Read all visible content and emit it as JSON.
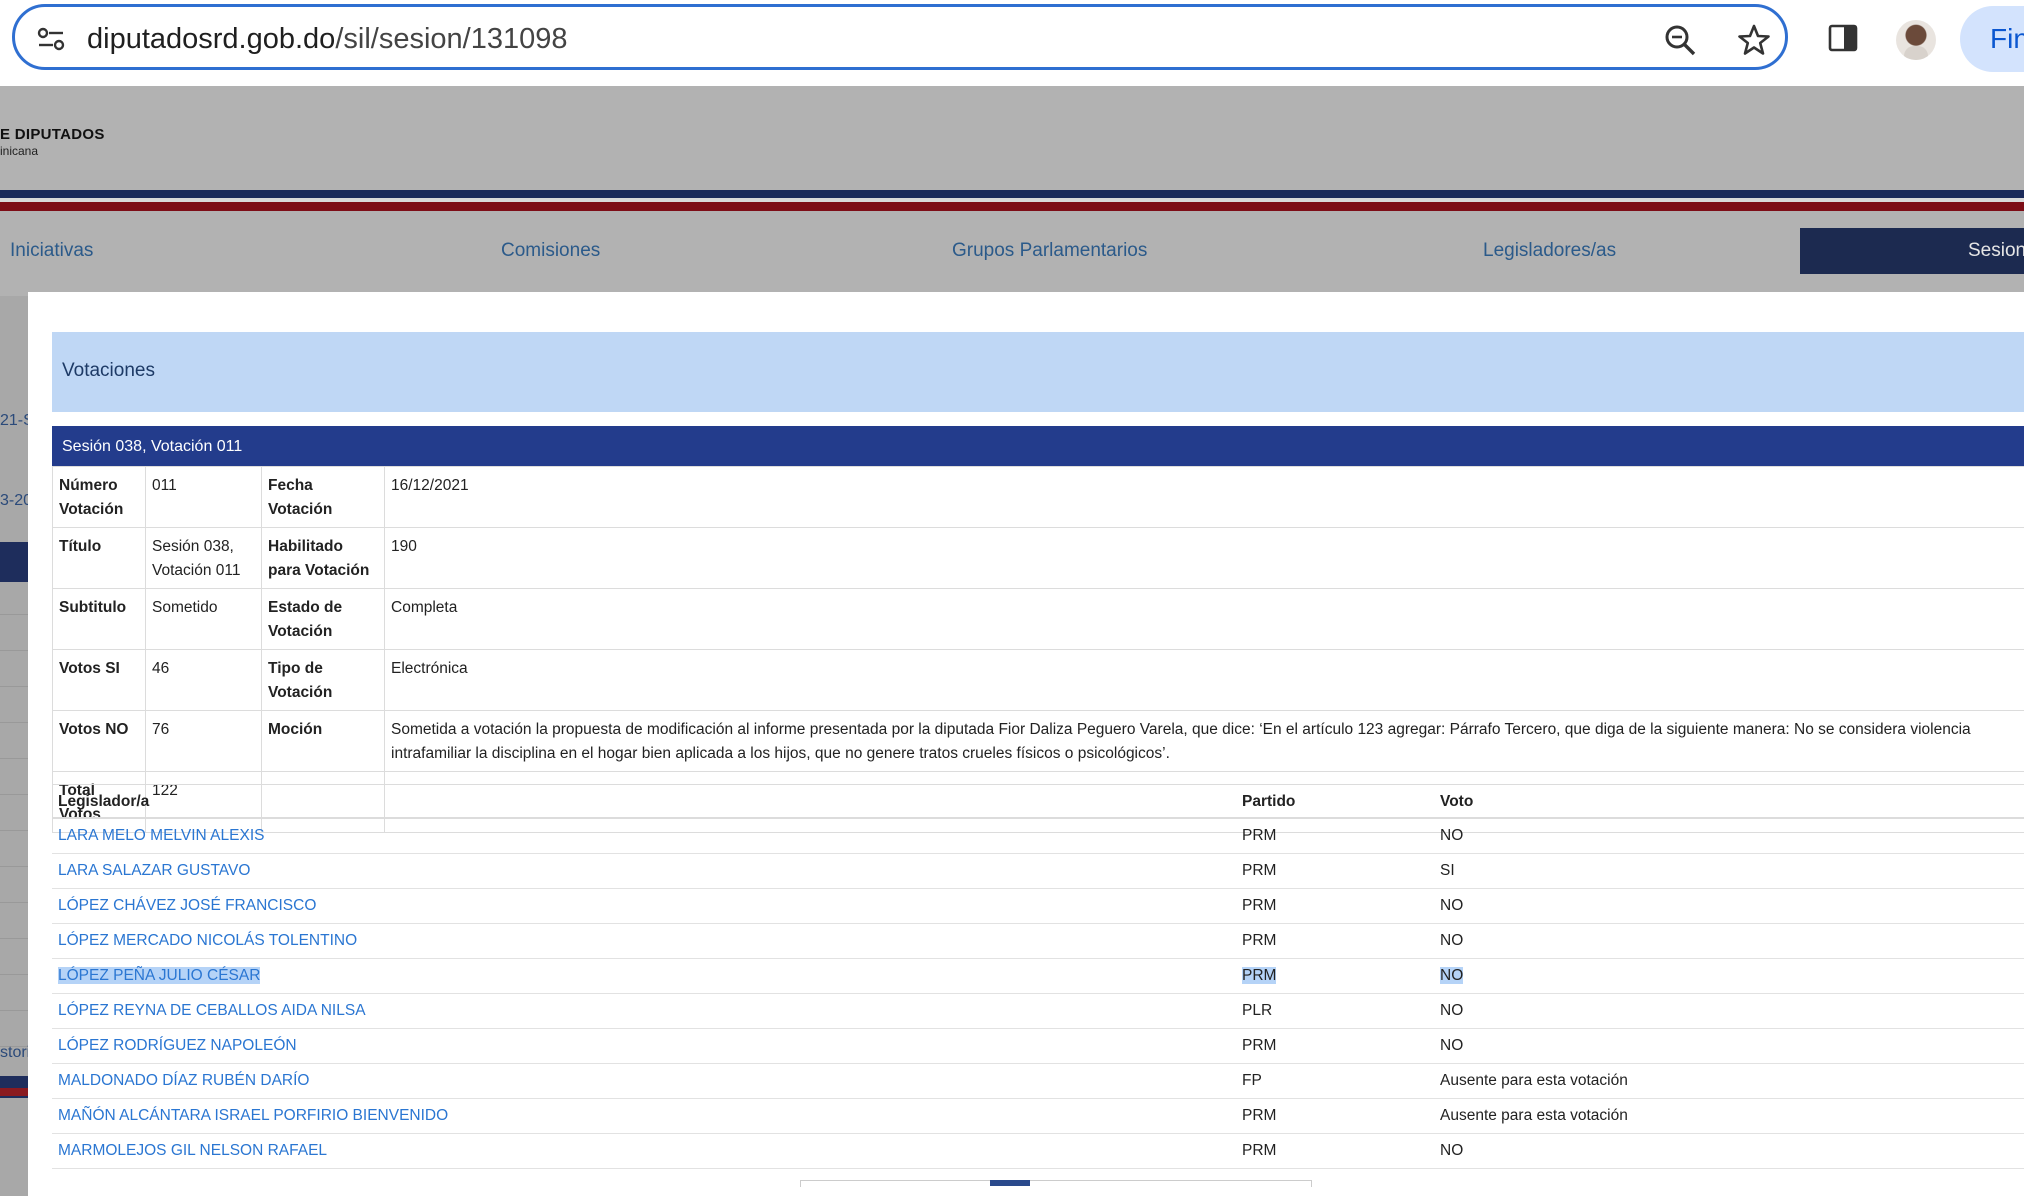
{
  "browser": {
    "url_host": "diputadosrd.gob.do",
    "url_path": "/sil/sesion/131098",
    "find_label": "Fin"
  },
  "site": {
    "name": "E DIPUTADOS",
    "sub": "inicana",
    "nav": [
      "Iniciativas",
      "Comisiones",
      "Grupos Parlamentarios",
      "Legisladores/as"
    ],
    "nav_active": "Sesion",
    "left_fragments": [
      "21-S",
      "3-20",
      "storia"
    ]
  },
  "modal": {
    "title": "Votaciones",
    "close": "×",
    "session_title": "Sesión 038, Votación 011",
    "details": [
      {
        "l1": "Número Votación",
        "v1": "011",
        "l2": "Fecha Votación",
        "v2": "16/12/2021"
      },
      {
        "l1": "Título",
        "v1": "Sesión 038, Votación 011",
        "l2": "Habilitado para Votación",
        "v2": "190"
      },
      {
        "l1": "Subtitulo",
        "v1": "Sometido",
        "l2": "Estado de Votación",
        "v2": "Completa"
      },
      {
        "l1": "Votos SI",
        "v1": "46",
        "l2": "Tipo de Votación",
        "v2": "Electrónica"
      },
      {
        "l1": "Votos NO",
        "v1": "76",
        "l2": "Moción",
        "v2": "Sometida a votación la propuesta de modificación al informe presentada por la diputada Fior Daliza Peguero Varela, que dice: ‘En el artículo 123 agregar: Párrafo Tercero, que diga de la siguiente manera: No se considera violencia intrafamiliar la disciplina en el hogar bien aplicada a los hijos, que no genere tratos crueles físicos o psicológicos’."
      },
      {
        "l1": "Total Votos",
        "v1": "122",
        "l2": "",
        "v2": ""
      }
    ],
    "votes_headers": [
      "Legislador/a",
      "Partido",
      "Voto"
    ],
    "votes": [
      {
        "name": "LARA MELO MELVIN ALEXIS",
        "party": "PRM",
        "vote": "NO"
      },
      {
        "name": "LARA SALAZAR GUSTAVO",
        "party": "PRM",
        "vote": "SI"
      },
      {
        "name": "LÓPEZ CHÁVEZ JOSÉ FRANCISCO",
        "party": "PRM",
        "vote": "NO"
      },
      {
        "name": "LÓPEZ MERCADO NICOLÁS TOLENTINO",
        "party": "PRM",
        "vote": "NO"
      },
      {
        "name": "LÓPEZ PEÑA JULIO CÉSAR",
        "party": "PRM",
        "vote": "NO"
      },
      {
        "name": "LÓPEZ REYNA DE CEBALLOS AIDA NILSA",
        "party": "PLR",
        "vote": "NO"
      },
      {
        "name": "LÓPEZ RODRÍGUEZ NAPOLEÓN",
        "party": "PRM",
        "vote": "NO"
      },
      {
        "name": "MALDONADO DÍAZ RUBÉN DARÍO",
        "party": "FP",
        "vote": "Ausente para esta votación"
      },
      {
        "name": "MAÑÓN ALCÁNTARA ISRAEL PORFIRIO BIENVENIDO",
        "party": "PRM",
        "vote": "Ausente para esta votación"
      },
      {
        "name": "MARMOLEJOS GIL NELSON RAFAEL",
        "party": "PRM",
        "vote": "NO"
      }
    ]
  }
}
